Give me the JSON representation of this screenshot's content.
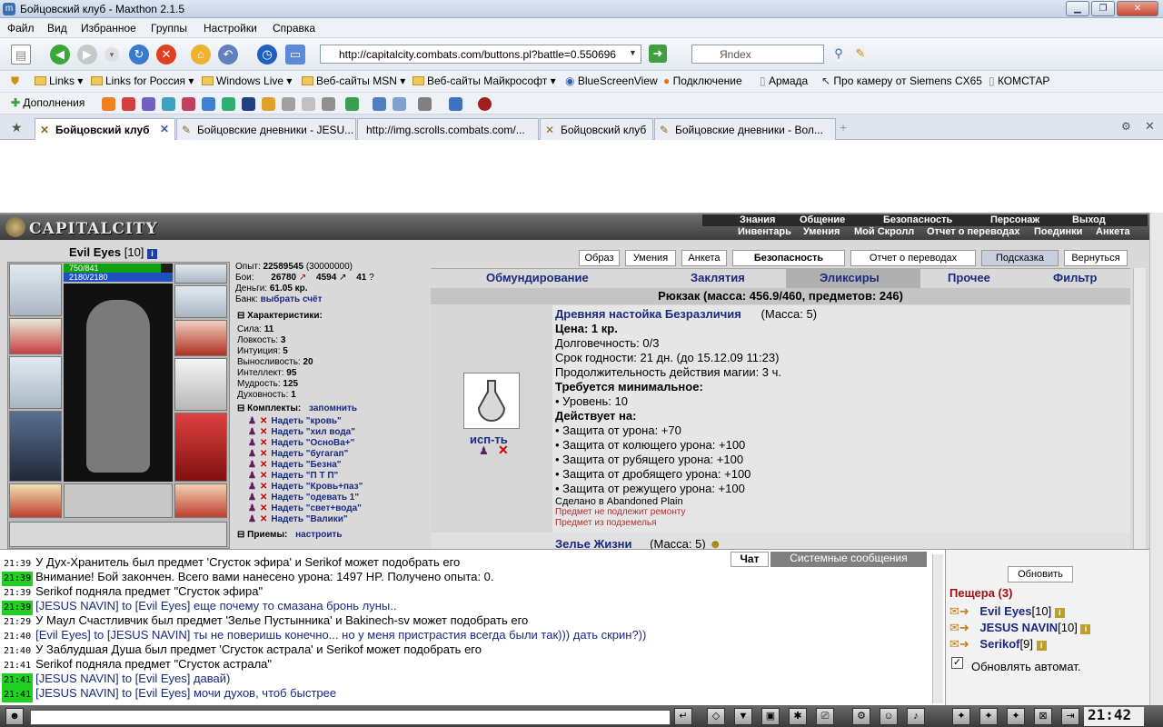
{
  "window": {
    "title": "Бойцовский клуб - Maxthon 2.1.5"
  },
  "menu": [
    "Файл",
    "Вид",
    "Избранное",
    "Группы",
    "Настройки",
    "Справка"
  ],
  "address": {
    "url": "http://capitalcity.combats.com/buttons.pl?battle=0.550696"
  },
  "search": {
    "placeholder": "Яndex"
  },
  "favorites": [
    "Links",
    "Links for Россия",
    "Windows Live",
    "Веб-сайты MSN",
    "Веб-сайты Майкрософт",
    "BlueScreenView",
    "Подключение",
    "Армада",
    "Про камеру от Siemens CX65",
    "КОМСТАР"
  ],
  "ext": {
    "label": "Дополнения"
  },
  "tabs": [
    "Бойцовский клуб",
    "Бойцовские дневники - JESU...",
    "http://img.scrolls.combats.com/...",
    "Бойцовский клуб",
    "Бойцовские дневники - Вол..."
  ],
  "game": {
    "logo": "CAPITALCITY",
    "nav_top": [
      "Знания",
      "Общение",
      "Безопасность",
      "Персонаж",
      "Выход"
    ],
    "nav_bottom": [
      "Инвентарь",
      "Умения",
      "Мой Скролл",
      "Отчет о переводах",
      "Поединки",
      "Анкета"
    ],
    "char": {
      "name": "Evil Eyes",
      "level": "[10]",
      "hp": "750/841",
      "hp_fraction": 0.89,
      "mana": "2180/2180"
    },
    "stats": {
      "exp_label": "Опыт:",
      "exp": "22589545",
      "exp_next": "(30000000)",
      "fights_label": "Бои:",
      "fights_win": "26780",
      "fights_loss": "4594",
      "fights_draw": "41",
      "money_label": "Деньги:",
      "money": "61.05 кр.",
      "bank_label": "Банк:",
      "bank": "выбрать счёт"
    },
    "characteristics_title": "Характеристики:",
    "characteristics": [
      {
        "name": "Сила:",
        "value": "11"
      },
      {
        "name": "Ловкость:",
        "value": "3"
      },
      {
        "name": "Интуиция:",
        "value": "5"
      },
      {
        "name": "Выносливость:",
        "value": "20"
      },
      {
        "name": "Интеллект:",
        "value": "95"
      },
      {
        "name": "Мудрость:",
        "value": "125"
      },
      {
        "name": "Духовность:",
        "value": "1"
      }
    ],
    "sets_title": "Комплекты:",
    "sets_remember": "запомнить",
    "sets": [
      "Надеть \"кровь\"",
      "Надеть \"хил вода\"",
      "Надеть \"ОсноВа+\"",
      "Надеть \"бугагап\"",
      "Надеть \"Безна\"",
      "Надеть \"П Т П\"",
      "Надеть \"Кровь+паз\"",
      "Надеть \"одевать 1\"",
      "Надеть \"свет+вода\"",
      "Надеть \"Валики\""
    ],
    "tricks_title": "Приемы:",
    "tricks_config": "настроить",
    "buttons": [
      "Образ",
      "Умения",
      "Анкета",
      "Безопасность",
      "Отчет о переводах",
      "Подсказка",
      "Вернуться"
    ],
    "item_tabs": [
      "Обмундирование",
      "Заклятия",
      "Эликсиры",
      "Прочее",
      "Фильтр"
    ],
    "backpack": "Рюкзак (масса: 456.9/460, предметов: 246)",
    "item": {
      "name": "Древняя настойка Безразличия",
      "mass": "(Масса: 5)",
      "use": "исп-ть",
      "lines": [
        {
          "t": "Цена: 1 кр.",
          "b": true
        },
        {
          "t": "Долговечность: 0/3",
          "b": false
        },
        {
          "t": "Срок годности: 21 дн. (до 15.12.09 11:23)",
          "b": false
        },
        {
          "t": "Продолжительность действия магии: 3 ч.",
          "b": false
        },
        {
          "t": "Требуется минимальное:",
          "b": true
        },
        {
          "t": "• Уровень: 10",
          "b": false
        },
        {
          "t": "Действует на:",
          "b": true
        },
        {
          "t": "• Защита от урона: +70",
          "b": false
        },
        {
          "t": "• Защита от колющего урона: +100",
          "b": false
        },
        {
          "t": "• Защита от рубящего урона: +100",
          "b": false
        },
        {
          "t": "• Защита от дробящего урона: +100",
          "b": false
        },
        {
          "t": "• Защита от режущего урона: +100",
          "b": false
        }
      ],
      "made": "Сделано в Abandoned Plain",
      "note1": "Предмет не подлежит ремонту",
      "note2": "Предмет из подземелья",
      "next_name": "Зелье Жизни",
      "next_mass": "(Масса: 5)"
    }
  },
  "chat": {
    "tabs": [
      "Чат",
      "Системные сообщения"
    ],
    "lines": [
      {
        "time": "21:39",
        "green": false,
        "text": "У Дух-Хранитель был предмет 'Сгусток эфира' и Serikof может подобрать его"
      },
      {
        "time": "21:39",
        "green": true,
        "text": "Внимание! Бой закончен. Всего вами нанесено урона: 1497 HP. Получено опыта: 0."
      },
      {
        "time": "21:39",
        "green": false,
        "text": "Serikof подняла предмет \"Сгусток эфира\""
      },
      {
        "time": "21:39",
        "green": true,
        "text": "[JESUS NAVIN] to [Evil Eyes] еще почему то смазана бронь луны.."
      },
      {
        "time": "21:29",
        "green": false,
        "text": "У Маул Счастливчик был предмет 'Зелье Пустынника' и Bakinech-sv может подобрать его"
      },
      {
        "time": "21:40",
        "green": false,
        "text": "[Evil Eyes] to [JESUS NAVIN] ты не поверишь конечно... но у меня пристрастия всегда были так))) дать скрин?))"
      },
      {
        "time": "21:40",
        "green": false,
        "text": "У Заблудшая Душа был предмет 'Сгусток астрала' и Serikof может подобрать его"
      },
      {
        "time": "21:41",
        "green": false,
        "text": "Serikof подняла предмет \"Сгусток астрала\""
      },
      {
        "time": "21:41",
        "green": true,
        "text": "[JESUS NAVIN] to [Evil Eyes] давай)"
      },
      {
        "time": "21:41",
        "green": true,
        "text": "[JESUS NAVIN] to [Evil Eyes] мочи духов, чтоб быстрее"
      }
    ]
  },
  "room": {
    "refresh": "Обновить",
    "name": "Пещера (3)",
    "players": [
      {
        "name": "Evil Eyes",
        "level": "[10]"
      },
      {
        "name": "JESUS NAVIN",
        "level": "[10]"
      },
      {
        "name": "Serikof",
        "level": "[9]"
      }
    ],
    "auto": "Обновлять автомат."
  },
  "clock": "21:42"
}
